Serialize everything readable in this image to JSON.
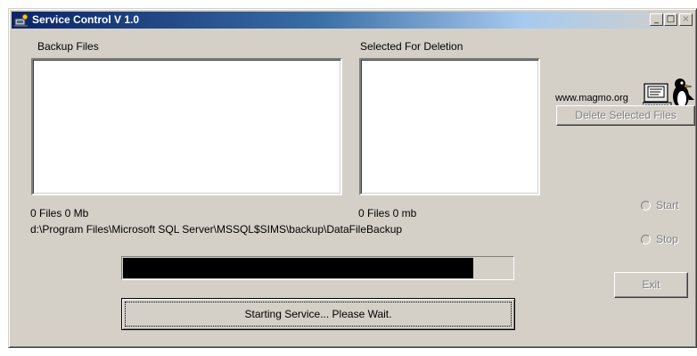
{
  "window": {
    "title": "Service Control V 1.0",
    "controls": {
      "minimize": "_",
      "maximize": "□",
      "close": "×"
    }
  },
  "labels": {
    "backup_files": "Backup Files",
    "selected_for_deletion": "Selected For Deletion",
    "website": "www.magmo.org",
    "backup_count": "0 Files 0 Mb",
    "deletion_count": "0 Files 0 mb",
    "backup_path": "d:\\Program Files\\Microsoft SQL Server\\MSSQL$SIMS\\backup\\DataFileBackup"
  },
  "buttons": {
    "delete_selected": "Delete Selected Files",
    "exit": "Exit",
    "status": "Starting Service... Please Wait."
  },
  "radios": {
    "start": "Start",
    "stop": "Stop"
  },
  "progress": {
    "fraction": 0.9
  },
  "icons": {
    "app": "app-icon",
    "logo": "penguin-computer-logo"
  },
  "colors": {
    "titlebar_start": "#0a246a",
    "face": "#d4d0c8",
    "progress": "#000000"
  }
}
